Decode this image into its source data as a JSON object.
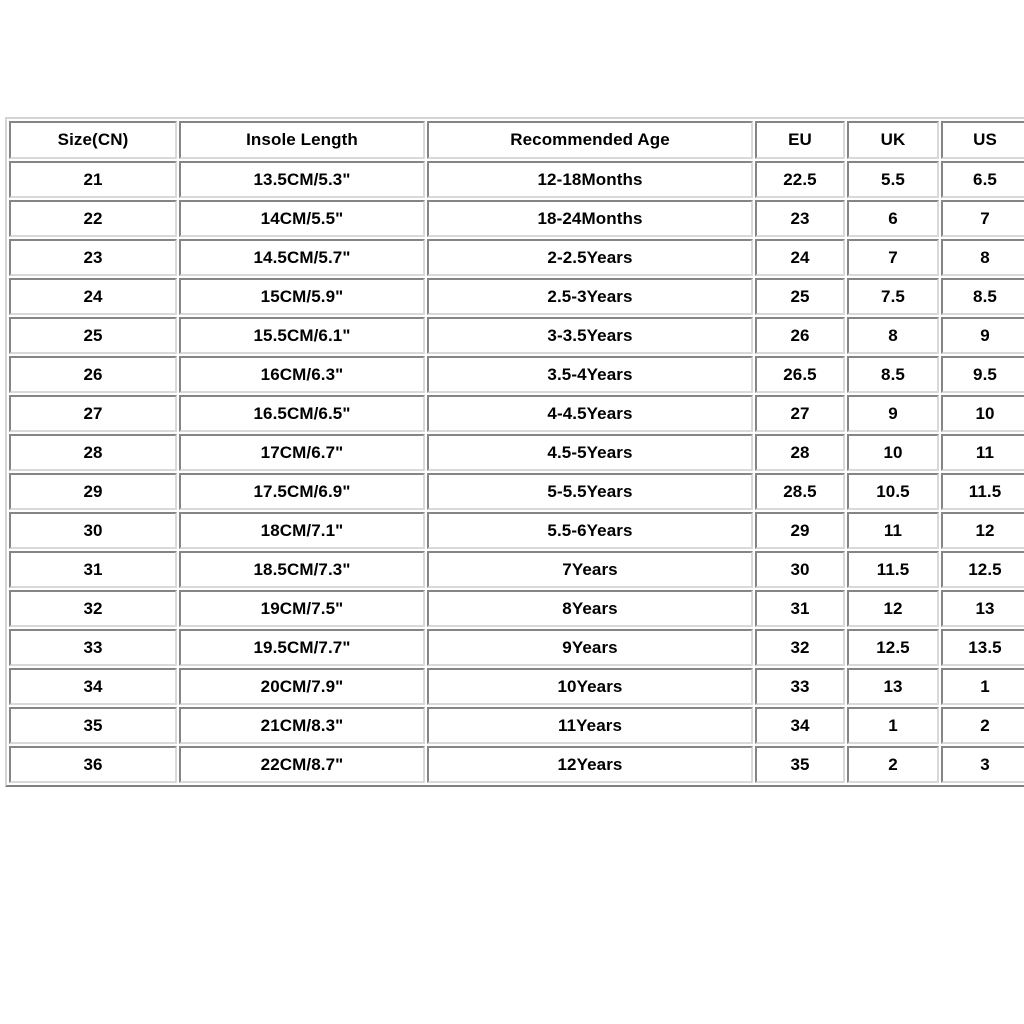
{
  "table": {
    "headers": [
      "Size(CN)",
      "Insole Length",
      "Recommended Age",
      "EU",
      "UK",
      "US"
    ],
    "rows": [
      [
        "21",
        "13.5CM/5.3\"",
        "12-18Months",
        "22.5",
        "5.5",
        "6.5"
      ],
      [
        "22",
        "14CM/5.5\"",
        "18-24Months",
        "23",
        "6",
        "7"
      ],
      [
        "23",
        "14.5CM/5.7\"",
        "2-2.5Years",
        "24",
        "7",
        "8"
      ],
      [
        "24",
        "15CM/5.9\"",
        "2.5-3Years",
        "25",
        "7.5",
        "8.5"
      ],
      [
        "25",
        "15.5CM/6.1\"",
        "3-3.5Years",
        "26",
        "8",
        "9"
      ],
      [
        "26",
        "16CM/6.3\"",
        "3.5-4Years",
        "26.5",
        "8.5",
        "9.5"
      ],
      [
        "27",
        "16.5CM/6.5\"",
        "4-4.5Years",
        "27",
        "9",
        "10"
      ],
      [
        "28",
        "17CM/6.7\"",
        "4.5-5Years",
        "28",
        "10",
        "11"
      ],
      [
        "29",
        "17.5CM/6.9\"",
        "5-5.5Years",
        "28.5",
        "10.5",
        "11.5"
      ],
      [
        "30",
        "18CM/7.1\"",
        "5.5-6Years",
        "29",
        "11",
        "12"
      ],
      [
        "31",
        "18.5CM/7.3\"",
        "7Years",
        "30",
        "11.5",
        "12.5"
      ],
      [
        "32",
        "19CM/7.5\"",
        "8Years",
        "31",
        "12",
        "13"
      ],
      [
        "33",
        "19.5CM/7.7\"",
        "9Years",
        "32",
        "12.5",
        "13.5"
      ],
      [
        "34",
        "20CM/7.9\"",
        "10Years",
        "33",
        "13",
        "1"
      ],
      [
        "35",
        "21CM/8.3\"",
        "11Years",
        "34",
        "1",
        "2"
      ],
      [
        "36",
        "22CM/8.7\"",
        "12Years",
        "35",
        "2",
        "3"
      ]
    ]
  },
  "colors": {
    "background": "#ffffff",
    "text": "#000000",
    "cell_border": "#d9d9d9",
    "frame_border": "#d4d4d4"
  }
}
